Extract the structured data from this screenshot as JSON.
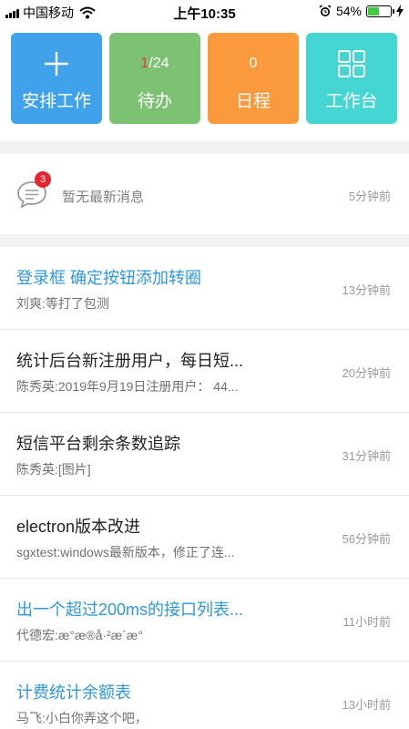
{
  "status_bar": {
    "carrier": "中国移动",
    "time": "上午10:35",
    "battery_percent": "54%",
    "battery_level": 0.54,
    "battery_color": "#3ecb3e",
    "icons": [
      "signal-icon",
      "wifi-icon",
      "alarm-icon",
      "battery-icon",
      "charging-icon"
    ]
  },
  "quick_actions": [
    {
      "icon": "plus-icon",
      "label": "安排工作",
      "color": "#3fa2ea"
    },
    {
      "count_current": "1",
      "count_rest": "/24",
      "label": "待办",
      "color": "#7dc173"
    },
    {
      "count": "0",
      "label": "日程",
      "color": "#fa9a3d"
    },
    {
      "icon": "grid-icon",
      "label": "工作台",
      "color": "#45d6d3"
    }
  ],
  "notification": {
    "icon": "message-bubble-icon",
    "badge": "3",
    "text": "暂无最新消息",
    "time": "5分钟前"
  },
  "tasks": [
    {
      "title": "登录框 确定按钮添加转圈",
      "subtitle": "刘爽:等打了包测",
      "time": "13分钟前",
      "highlight": true
    },
    {
      "title": "统计后台新注册用户，每日短...",
      "subtitle": "陈秀英:2019年9月19日注册用户： 44...",
      "time": "20分钟前",
      "highlight": false
    },
    {
      "title": "短信平台剩余条数追踪",
      "subtitle": "陈秀英:[图片]",
      "time": "31分钟前",
      "highlight": false
    },
    {
      "title": "electron版本改进",
      "subtitle": "sgxtest:windows最新版本，修正了连...",
      "time": "56分钟前",
      "highlight": false
    },
    {
      "title": "出一个超过200ms的接口列表...",
      "subtitle": "代德宏:æ°æ®å·²æ´æ°",
      "time": "11小时前",
      "highlight": true
    },
    {
      "title": "计费统计余额表",
      "subtitle": "马飞:小白你弄这个吧，",
      "time": "13小时前",
      "highlight": true
    }
  ]
}
